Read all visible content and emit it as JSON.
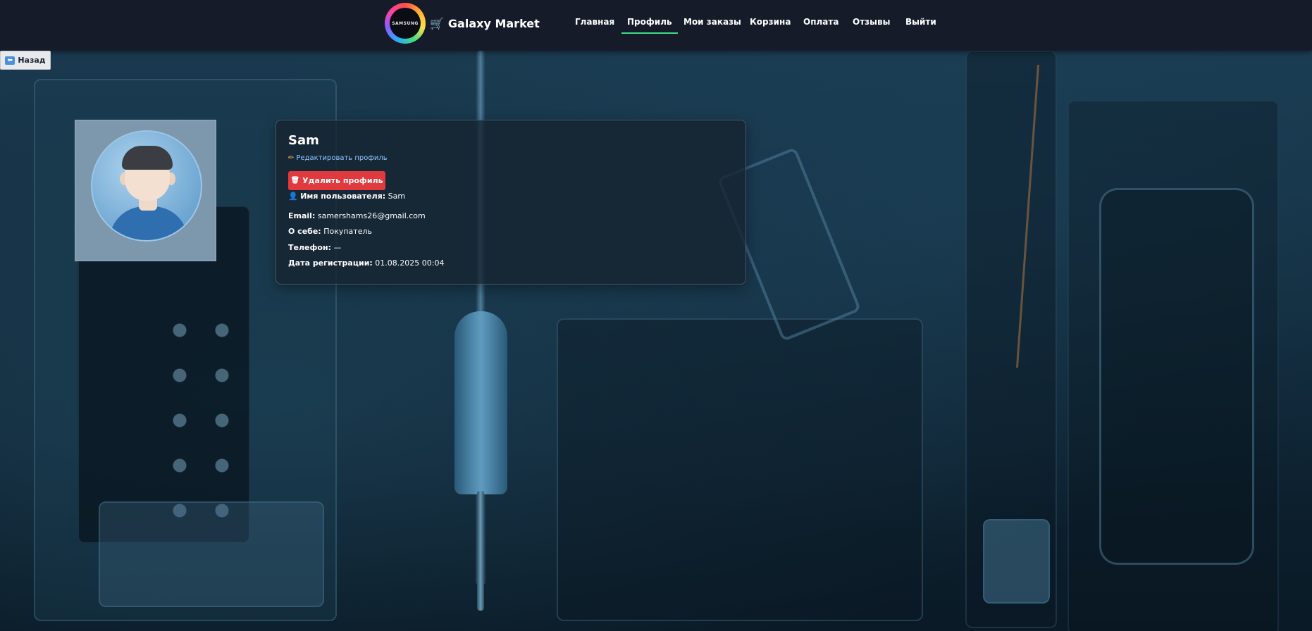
{
  "navbar": {
    "logo_text": "SAMSUNG",
    "brand_icon": "cart-icon",
    "brand_name": "Galaxy Market",
    "items": [
      {
        "label": "Главная"
      },
      {
        "label": "Профиль",
        "active": true
      },
      {
        "label": "Мои заказы"
      },
      {
        "label": "Корзина"
      },
      {
        "label": "Оплата"
      },
      {
        "label": "Отзывы"
      },
      {
        "label": "Выйти"
      }
    ],
    "active_accent": "#3ddc84"
  },
  "back_button": {
    "icon": "back-arrow-icon",
    "label": "Назад"
  },
  "profile": {
    "name": "Sam",
    "edit_label": "Редактировать профиль",
    "delete_label": "Удалить профиль",
    "delete_color": "#e0393e",
    "fields": {
      "username": {
        "label": "Имя пользователя:",
        "value": "Sam"
      },
      "email": {
        "label": "Email:",
        "value": "samershams26@gmail.com"
      },
      "about": {
        "label": "О себе:",
        "value": "Покупатель"
      },
      "phone": {
        "label": "Телефон:",
        "value": "—"
      },
      "registered": {
        "label": "Дата регистрации:",
        "value": "01.08.2025 00:04"
      }
    }
  }
}
